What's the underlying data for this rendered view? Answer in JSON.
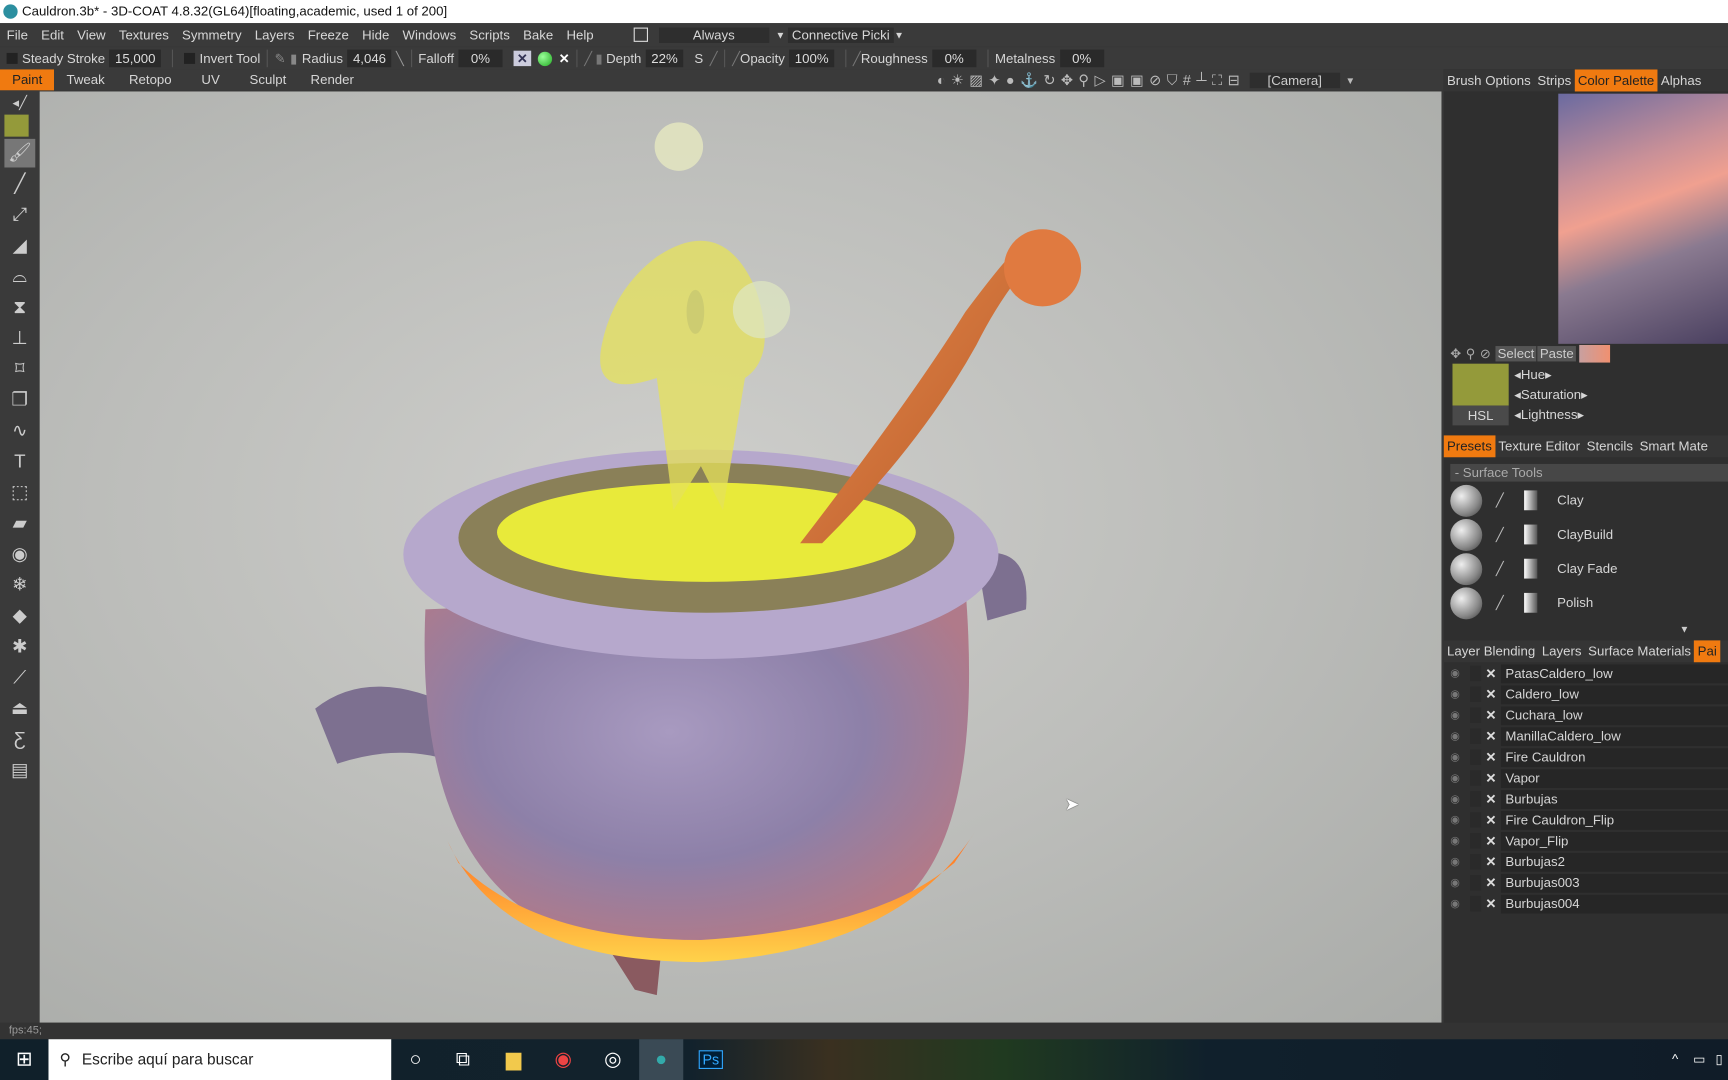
{
  "window": {
    "title": "Cauldron.3b* - 3D-COAT 4.8.32(GL64)[floating,academic, used 1 of 200]"
  },
  "menu": [
    "File",
    "Edit",
    "View",
    "Textures",
    "Symmetry",
    "Layers",
    "Freeze",
    "Hide",
    "Windows",
    "Scripts",
    "Bake",
    "Help"
  ],
  "menu_right": {
    "always": "Always",
    "connective": "Connective",
    "picki": "Picki"
  },
  "options": {
    "steady_stroke": "Steady  Stroke",
    "steady_value": "15,000",
    "invert_tool": "Invert  Tool",
    "radius": "Radius",
    "radius_value": "4,046",
    "falloff": "Falloff",
    "falloff_value": "0%",
    "depth": "Depth",
    "depth_value": "22%",
    "s": "S",
    "opacity": "Opacity",
    "opacity_value": "100%",
    "roughness": "Roughness",
    "roughness_value": "0%",
    "metalness": "Metalness",
    "metalness_value": "0%"
  },
  "modes": [
    "Paint",
    "Tweak",
    "Retopo",
    "UV",
    "Sculpt",
    "Render"
  ],
  "active_mode": "Paint",
  "camera": "[Camera]",
  "right_tabs": [
    "Brush  Options",
    "Strips",
    "Color  Palette",
    "Alphas"
  ],
  "active_right_tab": "Color  Palette",
  "color": {
    "select": "Select",
    "paste": "Paste",
    "hsl": "HSL",
    "hue": "Hue",
    "saturation": "Saturation",
    "lightness": "Lightness",
    "swatch": "#949a3a"
  },
  "preset_tabs": [
    "Presets",
    "Texture  Editor",
    "Stencils",
    "Smart  Mate"
  ],
  "surface_tools": "-  Surface  Tools",
  "presets": [
    "Clay",
    "ClayBuild",
    "Clay  Fade",
    "Polish"
  ],
  "layer_tabs": [
    "Layer  Blending",
    "Layers",
    "Surface  Materials",
    "Pai"
  ],
  "layers": [
    "PatasCaldero_low",
    "Caldero_low",
    "Cuchara_low",
    "ManillaCaldero_low",
    "Fire  Cauldron",
    "Vapor",
    "Burbujas",
    "Fire  Cauldron_Flip",
    "Vapor_Flip",
    "Burbujas2",
    "Burbujas003",
    "Burbujas004"
  ],
  "status": {
    "fps": "fps:45;"
  },
  "taskbar": {
    "search_placeholder": "Escribe aquí para buscar",
    "apps": [
      "cortana-icon",
      "task-view-icon",
      "file-explorer-icon",
      "chrome-icon",
      "obs-icon",
      "3dcoat-icon",
      "photoshop-icon"
    ],
    "ps": "Ps"
  },
  "accent": "#f07a10"
}
